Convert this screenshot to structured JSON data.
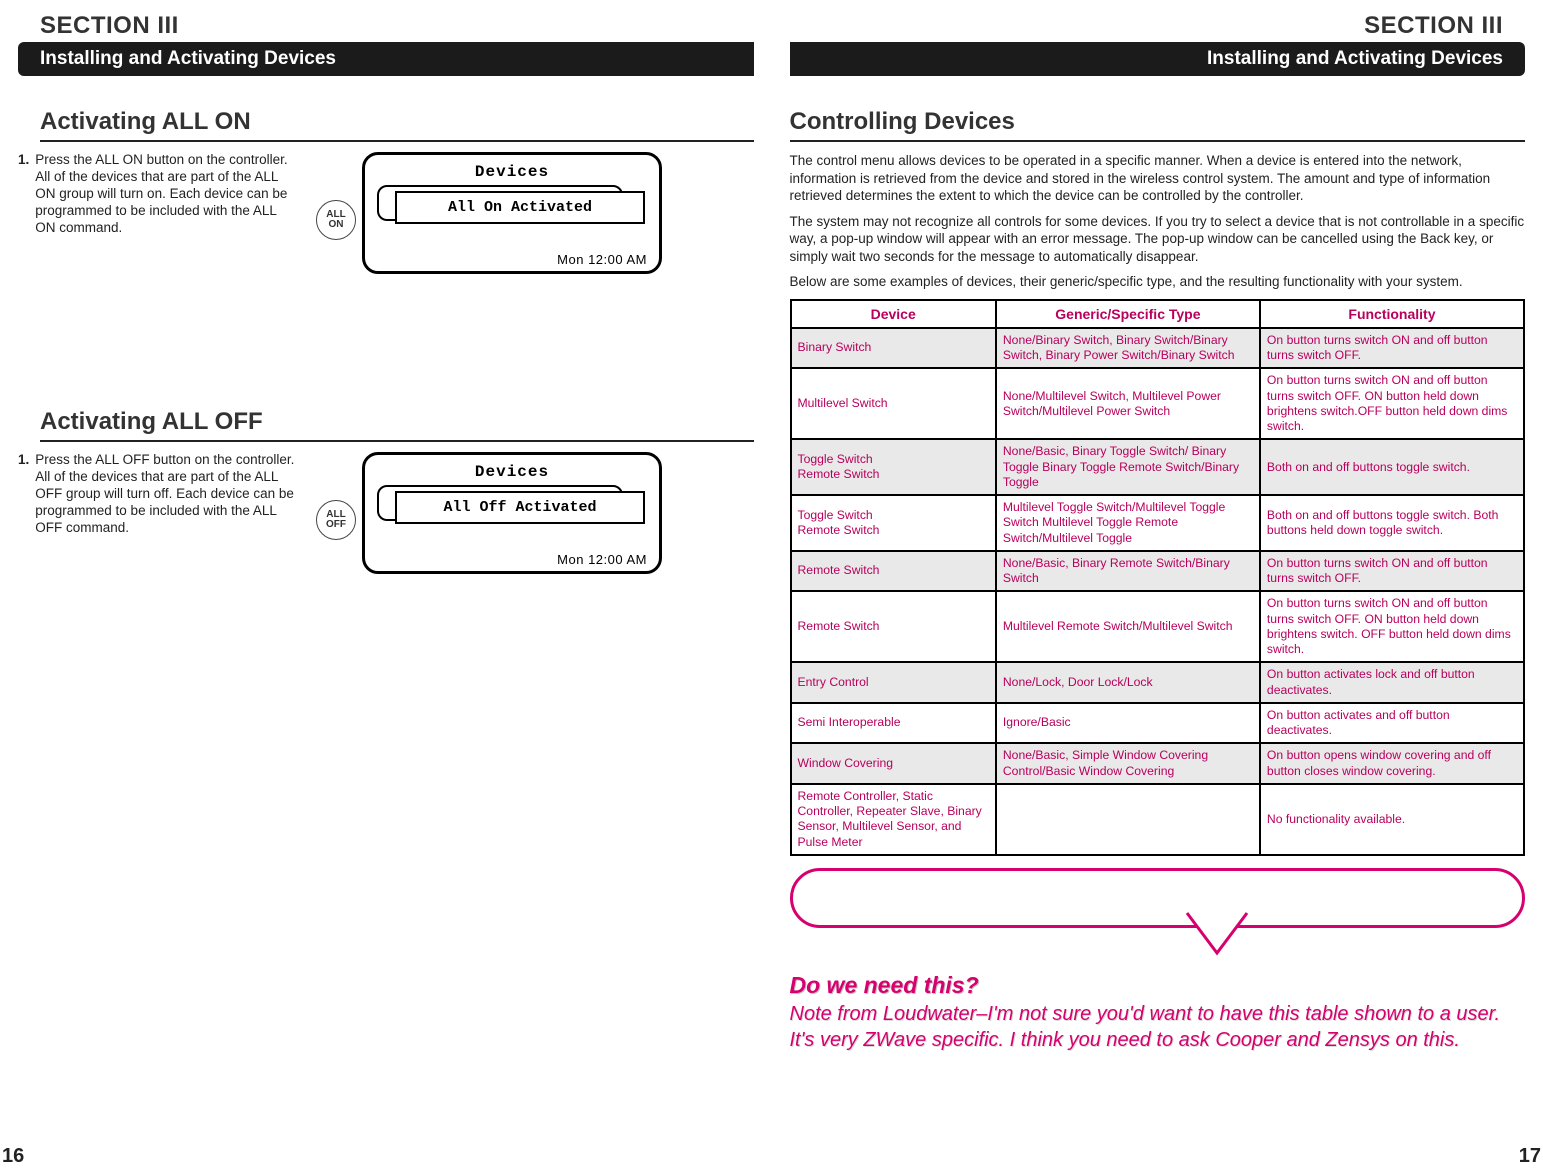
{
  "section_label": "SECTION III",
  "section_bar": "Installing and Activating Devices",
  "left": {
    "h1": "Activating ALL ON",
    "step1_num": "1.",
    "step1_text": "Press the ALL ON button on the controller. All of the devices that are part of the ALL ON group will turn on. Each device can be programmed to be included with the ALL ON command.",
    "btn1": "ALL\nON",
    "lcd1_title": "Devices",
    "lcd1_popup": "All On Activated",
    "lcd1_time": "Mon 12:00 AM",
    "h2": "Activating ALL OFF",
    "step2_num": "1.",
    "step2_text": "Press the ALL OFF button on the controller. All of the devices that are part of the ALL OFF group will turn off. Each device can be programmed to be included with the ALL OFF command.",
    "btn2": "ALL\nOFF",
    "lcd2_title": "Devices",
    "lcd2_popup": "All Off Activated",
    "lcd2_time": "Mon 12:00 AM",
    "page_num": "16"
  },
  "right": {
    "h1": "Controlling Devices",
    "p1": "The control menu allows devices to be operated in a specific manner. When a device is entered into the network, information is retrieved from the device and stored in the wireless control system. The amount and type of information retrieved determines the extent to which the device can be controlled by the controller.",
    "p2": "The system may not recognize all controls for some devices. If you try to select a device that is not controllable in a specific way, a pop-up window will appear with an error message. The pop-up window can be cancelled using the Back key, or simply wait two seconds for the message to automatically disappear.",
    "p3": "Below are some examples of devices, their generic/specific type, and the resulting functionality with your system.",
    "th0": "Device",
    "th1": "Generic/Specific Type",
    "th2": "Functionality",
    "rows": [
      {
        "z": true,
        "c0": "Binary Switch",
        "c1": "None/Binary Switch, Binary Switch/Binary Switch, Binary Power Switch/Binary Switch",
        "c2": "On button turns switch ON and off button turns switch OFF."
      },
      {
        "z": false,
        "c0": "Multilevel Switch",
        "c1": "None/Multilevel Switch, Multilevel Power Switch/Multilevel Power Switch",
        "c2": "On button turns switch ON and off button turns switch OFF. ON button held down brightens switch.OFF button held down dims switch."
      },
      {
        "z": true,
        "c0": "Toggle Switch\nRemote Switch",
        "c1": "None/Basic, Binary Toggle Switch/ Binary Toggle Binary Toggle Remote Switch/Binary Toggle",
        "c2": "Both on and off buttons toggle switch."
      },
      {
        "z": false,
        "c0": "Toggle Switch\nRemote Switch",
        "c1": "Multilevel Toggle Switch/Multilevel Toggle Switch Multilevel Toggle Remote Switch/Multilevel Toggle",
        "c2": "Both on and off buttons toggle switch. Both buttons held down toggle switch."
      },
      {
        "z": true,
        "c0": "Remote Switch",
        "c1": "None/Basic, Binary Remote Switch/Binary Switch",
        "c2": "On button turns switch ON and off button turns switch OFF."
      },
      {
        "z": false,
        "c0": "Remote Switch",
        "c1": "Multilevel Remote Switch/Multilevel Switch",
        "c2": "On button turns switch ON and off button turns switch OFF. ON button held down brightens switch. OFF button held down dims switch."
      },
      {
        "z": true,
        "c0": "Entry Control",
        "c1": "None/Lock, Door Lock/Lock",
        "c2": "On button activates lock and off button deactivates."
      },
      {
        "z": false,
        "c0": "Semi Interoperable",
        "c1": "Ignore/Basic",
        "c2": "On button activates and off button deactivates."
      },
      {
        "z": true,
        "c0": "Window Covering",
        "c1": "None/Basic, Simple Window Covering Control/Basic Window Covering",
        "c2": "On button opens window covering and off button closes window covering."
      },
      {
        "z": false,
        "c0": "Remote Controller, Static Controller, Repeater Slave, Binary Sensor, Multilevel Sensor, and Pulse Meter",
        "c1": "",
        "c2": "No functionality available."
      }
    ],
    "note_title": "Do we need this?",
    "note_body": "Note from Loudwater–I'm not sure you'd want to have this table shown to a user. It's very ZWave specific. I think you need to ask Cooper and Zensys on this.",
    "page_num": "17"
  }
}
